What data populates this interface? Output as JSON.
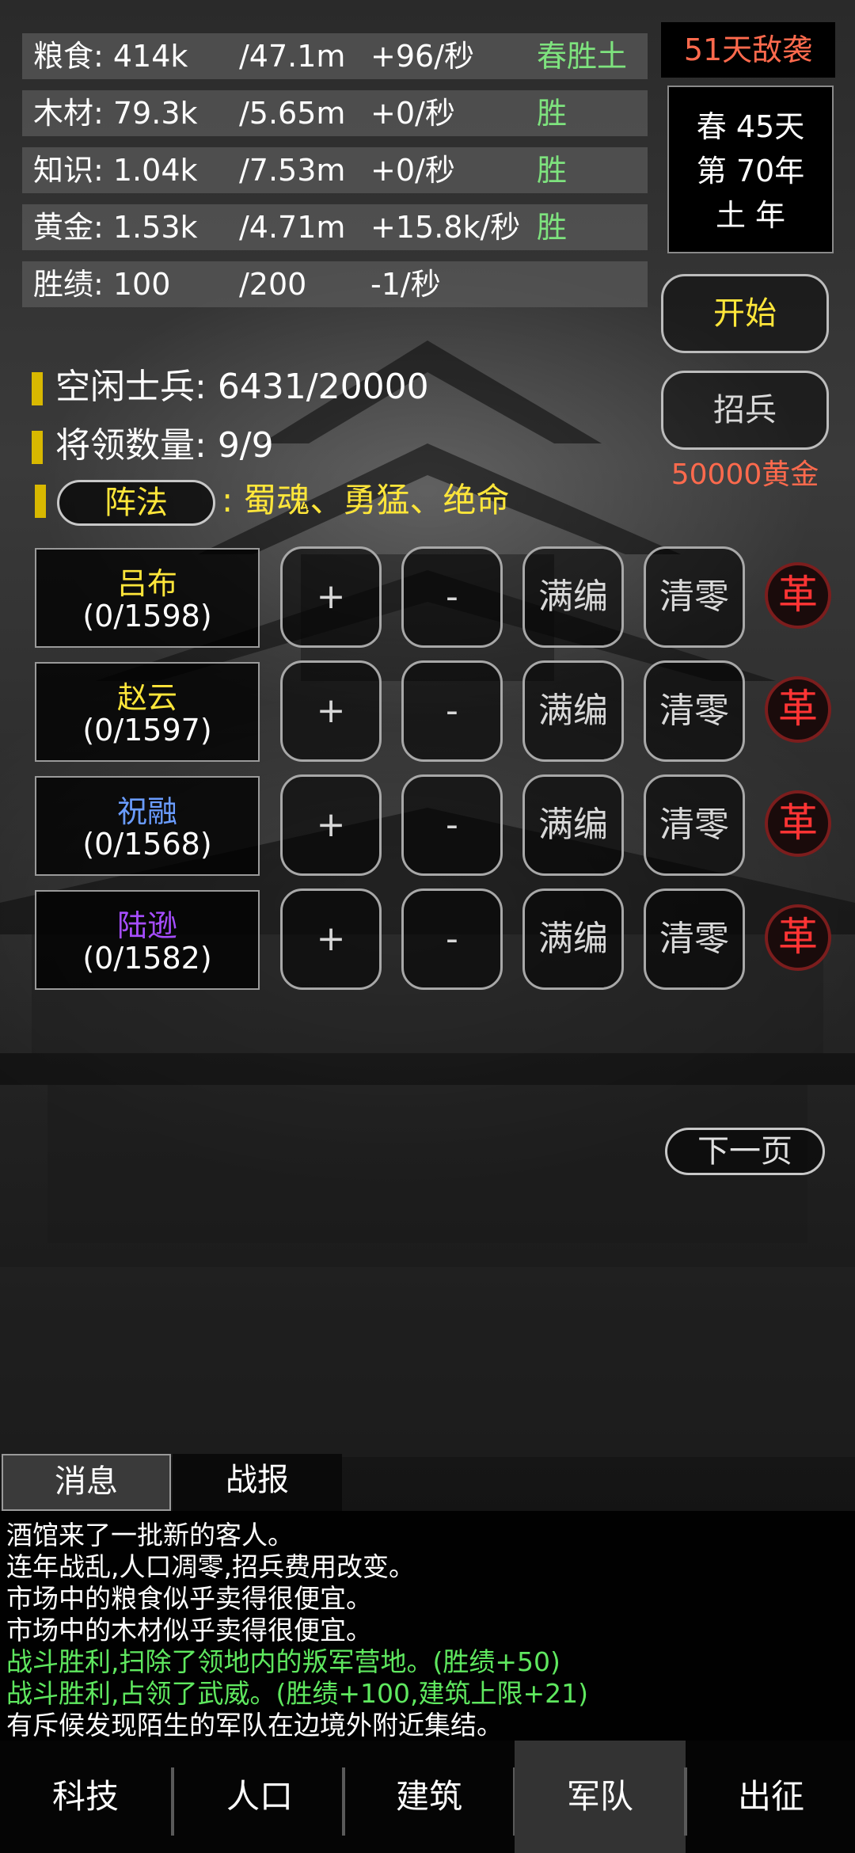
{
  "resources": [
    {
      "name": "粮食: 414k",
      "limit": "/47.1m",
      "rate": "+96/秒",
      "tag": "春胜土"
    },
    {
      "name": "木材: 79.3k",
      "limit": "/5.65m",
      "rate": "+0/秒",
      "tag": "胜"
    },
    {
      "name": "知识: 1.04k",
      "limit": "/7.53m",
      "rate": "+0/秒",
      "tag": "胜"
    },
    {
      "name": "黄金: 1.53k",
      "limit": "/4.71m",
      "rate": "+15.8k/秒",
      "tag": "胜"
    },
    {
      "name": "胜绩: 100",
      "limit": "/200",
      "rate": "-1/秒",
      "tag": ""
    }
  ],
  "raid_warning": "51天敌袭",
  "date": {
    "season_day": "春 45天",
    "year": "第 70年",
    "element": "土 年"
  },
  "buttons": {
    "start": "开始",
    "recruit": "招兵",
    "recruit_cost": "50000黄金",
    "next_page": "下一页"
  },
  "army": {
    "idle_label": "空闲士兵: ",
    "idle_value": "6431/20000",
    "generals_label": "将领数量: ",
    "generals_value": "9/9",
    "formation_button": "阵法",
    "formation_value": ": 蜀魂、勇猛、绝命"
  },
  "generals": [
    {
      "name": "吕布",
      "count": "(0/1598)",
      "color": "#ffe63a"
    },
    {
      "name": "赵云",
      "count": "(0/1597)",
      "color": "#ffe63a"
    },
    {
      "name": "祝融",
      "count": "(0/1568)",
      "color": "#6a9cff"
    },
    {
      "name": "陆逊",
      "count": "(0/1582)",
      "color": "#a64dff"
    }
  ],
  "general_actions": {
    "plus": "+",
    "minus": "-",
    "fill": "满编",
    "clear": "清零",
    "revolt": "革"
  },
  "message_tabs": {
    "messages": "消息",
    "reports": "战报"
  },
  "messages": [
    {
      "text": "酒馆来了一批新的客人。",
      "type": "normal"
    },
    {
      "text": "连年战乱,人口凋零,招兵费用改变。",
      "type": "normal"
    },
    {
      "text": "市场中的粮食似乎卖得很便宜。",
      "type": "normal"
    },
    {
      "text": "市场中的木材似乎卖得很便宜。",
      "type": "normal"
    },
    {
      "text": "战斗胜利,扫除了领地内的叛军营地。(胜绩+50)",
      "type": "green"
    },
    {
      "text": "战斗胜利,占领了武威。(胜绩+100,建筑上限+21)",
      "type": "green"
    },
    {
      "text": "有斥候发现陌生的军队在边境外附近集结。",
      "type": "normal"
    }
  ],
  "nav": [
    "科技",
    "人口",
    "建筑",
    "军队",
    "出征"
  ],
  "nav_active": "军队"
}
